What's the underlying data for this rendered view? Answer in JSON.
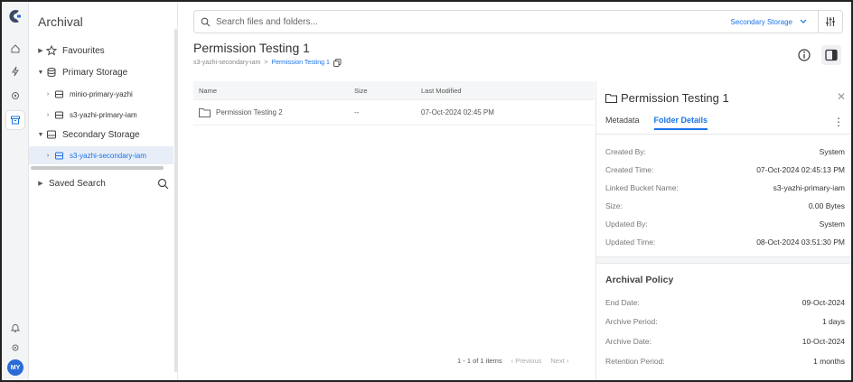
{
  "app": {
    "title": "Archival"
  },
  "rail": {
    "avatar_initials": "MY",
    "icons": [
      "app-logo",
      "home-icon",
      "bolt-icon",
      "settings-cog-icon",
      "archive-icon",
      "bell-icon",
      "gear-icon"
    ]
  },
  "sidebar": {
    "favourites": "Favourites",
    "primary_storage": "Primary Storage",
    "primary_items": [
      "minio-primary-yazhi",
      "s3-yazhi-primary-iam"
    ],
    "secondary_storage": "Secondary Storage",
    "secondary_items": [
      "s3-yazhi-secondary-iam"
    ],
    "saved_search": "Saved Search"
  },
  "search": {
    "placeholder": "Search files and folders...",
    "scope": "Secondary Storage"
  },
  "page": {
    "title": "Permission Testing 1",
    "breadcrumb_root": "s3-yazhi-secondary-iam",
    "breadcrumb_sep": ">",
    "breadcrumb_current": "Permission Testing 1"
  },
  "table": {
    "columns": [
      "Name",
      "Size",
      "Last Modified"
    ],
    "rows": [
      {
        "name": "Permission Testing 2",
        "size": "--",
        "modified": "07-Oct-2024 02:45 PM"
      }
    ]
  },
  "pager": {
    "summary": "1 - 1 of 1 items",
    "prev": "‹ Previous",
    "next": "Next ›"
  },
  "details": {
    "title": "Permission Testing 1",
    "tabs": [
      "Metadata",
      "Folder Details"
    ],
    "active_tab": "Folder Details",
    "fields": [
      {
        "k": "Created By:",
        "v": "System"
      },
      {
        "k": "Created Time:",
        "v": "07-Oct-2024 02:45:13 PM"
      },
      {
        "k": "Linked Bucket Name:",
        "v": "s3-yazhi-primary-iam"
      },
      {
        "k": "Size:",
        "v": "0.00 Bytes"
      },
      {
        "k": "Updated By:",
        "v": "System"
      },
      {
        "k": "Updated Time:",
        "v": "08-Oct-2024 03:51:30 PM"
      }
    ],
    "policy_title": "Archival Policy",
    "policy": [
      {
        "k": "End Date:",
        "v": "09-Oct-2024"
      },
      {
        "k": "Archive Period:",
        "v": "1 days"
      },
      {
        "k": "Archive Date:",
        "v": "10-Oct-2024"
      },
      {
        "k": "Retention Period:",
        "v": "1 months"
      }
    ]
  },
  "colors": {
    "accent": "#1a73e8",
    "rail_bg": "#f3f4f6",
    "header_bg": "#f5f6f7"
  }
}
